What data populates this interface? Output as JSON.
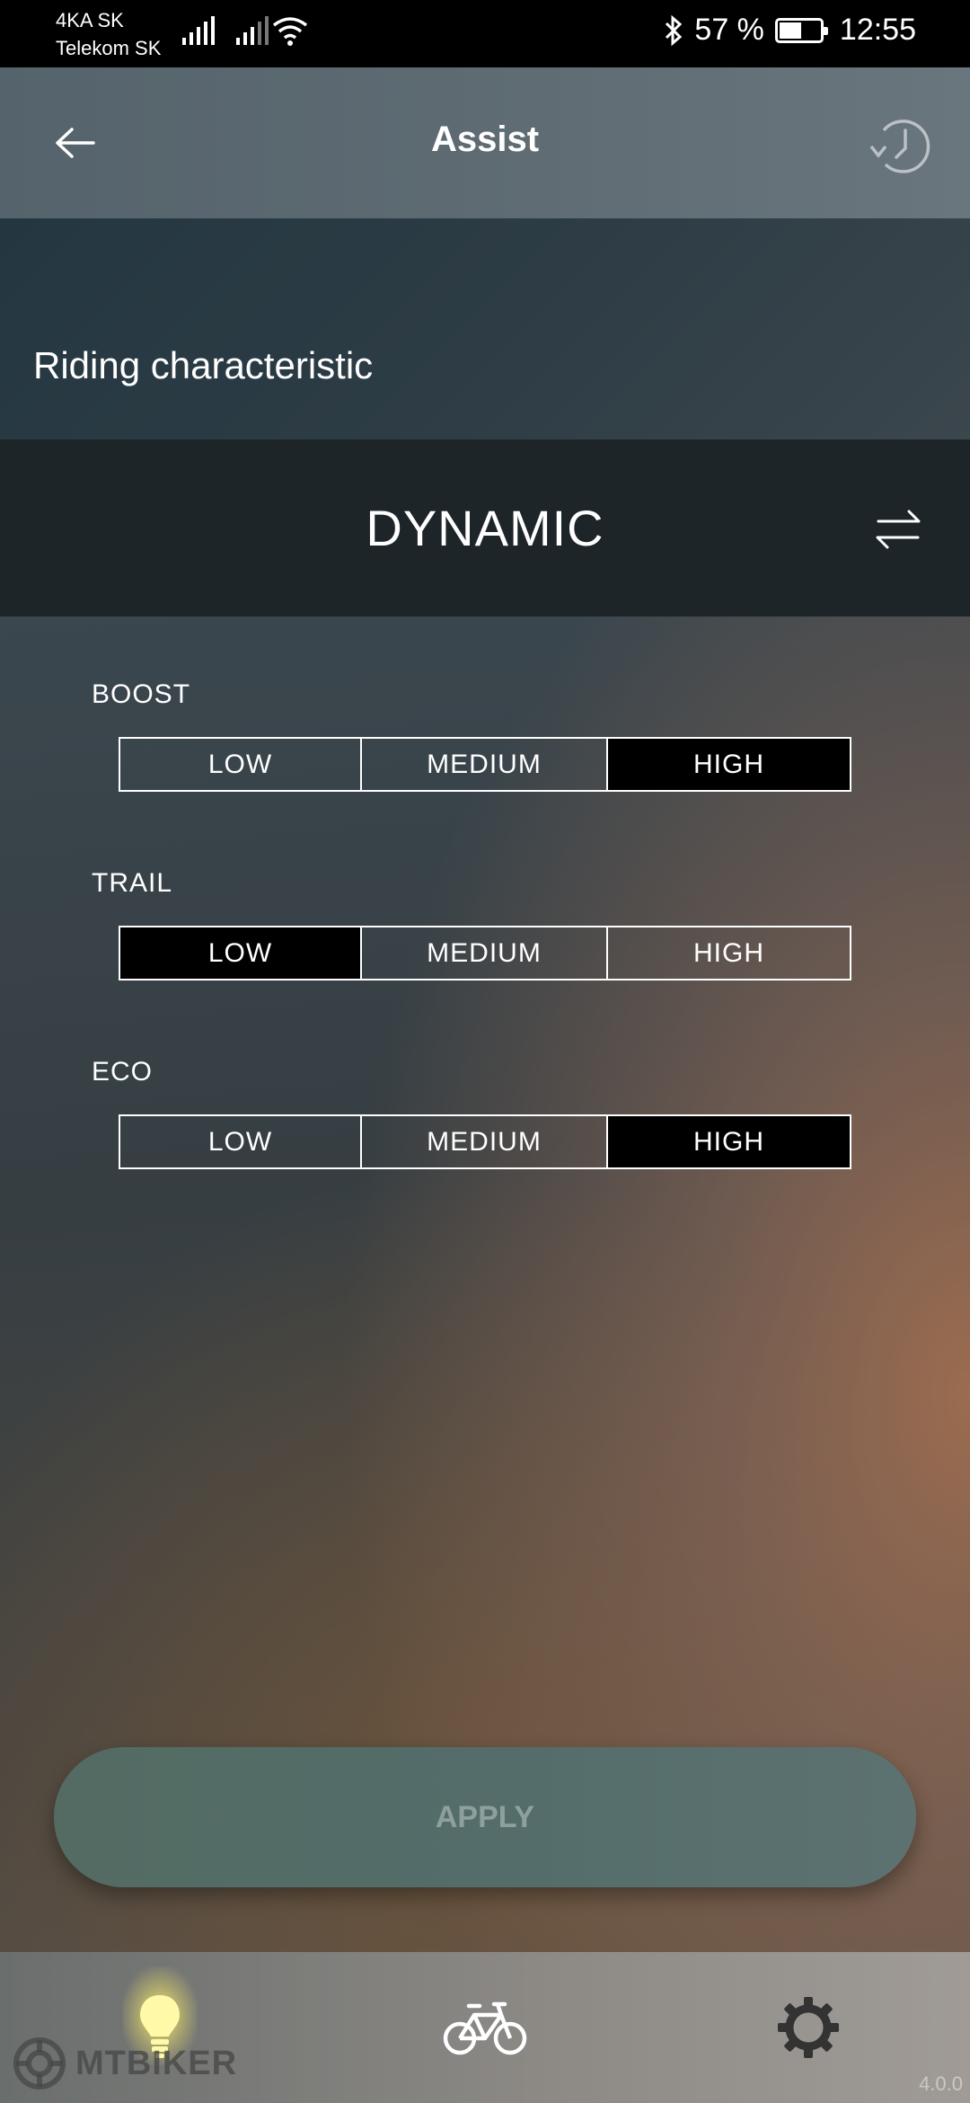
{
  "status_bar": {
    "carrier_line1": "4KA SK",
    "carrier_line2": "Telekom SK",
    "battery_percent": "57 %",
    "battery_level": 0.57,
    "time": "12:55",
    "icons": [
      "signal-icon",
      "signal-icon",
      "wifi-icon",
      "bluetooth-icon",
      "battery-icon"
    ]
  },
  "header": {
    "title": "Assist",
    "back_icon": "arrow-left-icon",
    "history_icon": "history-clock-icon"
  },
  "section": {
    "title": "Riding characteristic"
  },
  "mode": {
    "label": "DYNAMIC",
    "swap_icon": "swap-arrows-icon"
  },
  "groups": [
    {
      "label": "BOOST",
      "options": [
        "LOW",
        "MEDIUM",
        "HIGH"
      ],
      "selected": "HIGH"
    },
    {
      "label": "TRAIL",
      "options": [
        "LOW",
        "MEDIUM",
        "HIGH"
      ],
      "selected": "LOW"
    },
    {
      "label": "ECO",
      "options": [
        "LOW",
        "MEDIUM",
        "HIGH"
      ],
      "selected": "HIGH"
    }
  ],
  "apply": {
    "label": "APPLY"
  },
  "bottom_nav": {
    "items": [
      {
        "icon": "lightbulb-icon",
        "active": true
      },
      {
        "icon": "bicycle-icon",
        "active": false
      },
      {
        "icon": "gear-icon",
        "active": false
      }
    ]
  },
  "watermark": {
    "text": "MTBIKER"
  },
  "version": "4.0.0",
  "colors": {
    "selected_segment": "#000000",
    "active_glow": "#fff478"
  }
}
